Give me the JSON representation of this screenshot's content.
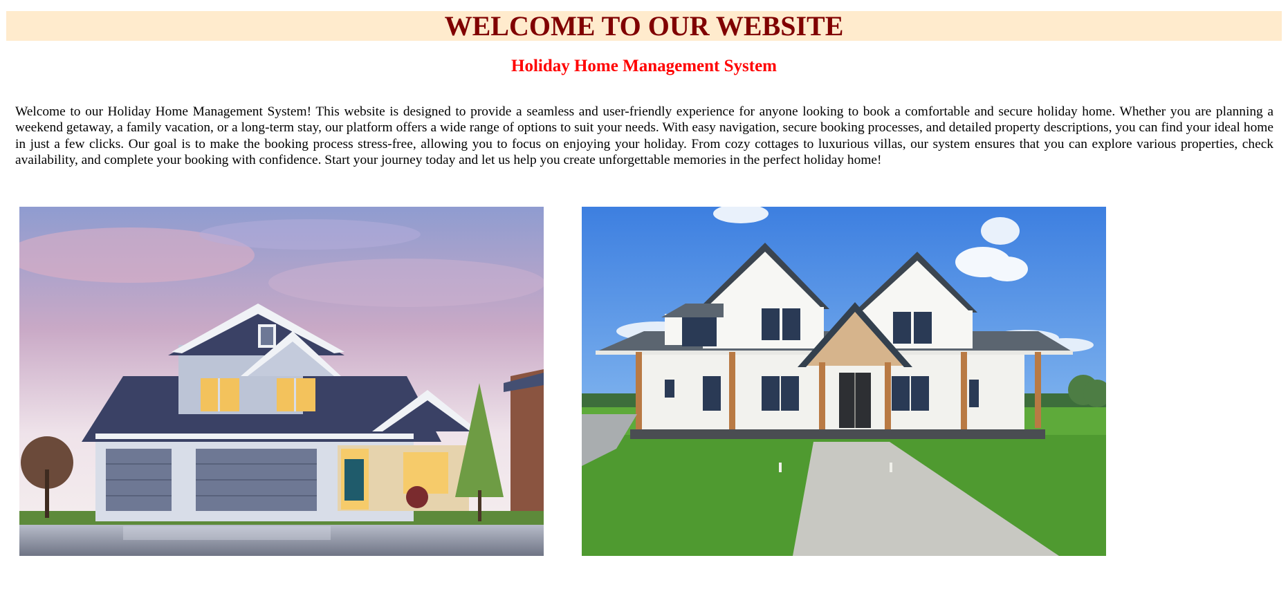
{
  "header": {
    "title": "WELCOME TO OUR WEBSITE",
    "subtitle": "Holiday Home Management System"
  },
  "intro": {
    "text": "Welcome to our Holiday Home Management System! This website is designed to provide a seamless and user-friendly experience for anyone looking to book a comfortable and secure holiday home. Whether you are planning a weekend getaway, a family vacation, or a long-term stay, our platform offers a wide range of options to suit your needs. With easy navigation, secure booking processes, and detailed property descriptions, you can find your ideal home in just a few clicks. Our goal is to make the booking process stress-free, allowing you to focus on enjoying your holiday. From cozy cottages to luxurious villas, our system ensures that you can explore various properties, check availability, and complete your booking with confidence. Start your journey today and let us help you create unforgettable memories in the perfect holiday home!"
  },
  "gallery": {
    "images": [
      {
        "name": "house-photo-dusk",
        "description": "Two-storey house with dark roof and garage at dusk"
      },
      {
        "name": "house-photo-farmhouse",
        "description": "White modern farmhouse with front lawn and walkway"
      }
    ]
  },
  "colors": {
    "banner_background": "#ffebcd",
    "title_color": "#800000",
    "subtitle_color": "#ff0000"
  }
}
